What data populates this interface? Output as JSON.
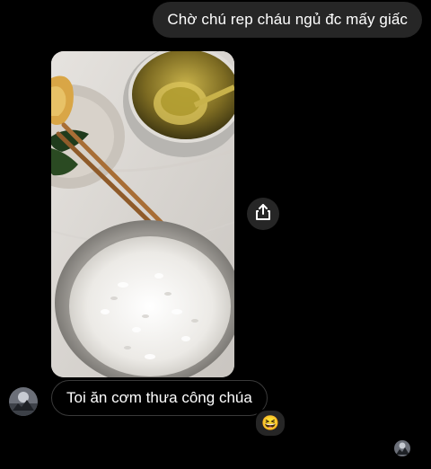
{
  "thread": {
    "messages": [
      {
        "direction": "outgoing",
        "text": "Chờ chú rep cháu ngủ đc mấy giấc"
      },
      {
        "direction": "incoming",
        "type": "photo",
        "description_icon": "meal-photo"
      },
      {
        "direction": "incoming",
        "text": "Toi ăn cơm thưa công chúa",
        "reaction": "😆"
      }
    ]
  },
  "icons": {
    "share": "share-icon",
    "sender_avatar": "avatar",
    "seen_avatar": "seen-avatar"
  },
  "colors": {
    "background": "#000000",
    "outgoing_bubble": "#262626",
    "incoming_bubble_border": "#3a3a3a",
    "text": "#ffffff"
  }
}
